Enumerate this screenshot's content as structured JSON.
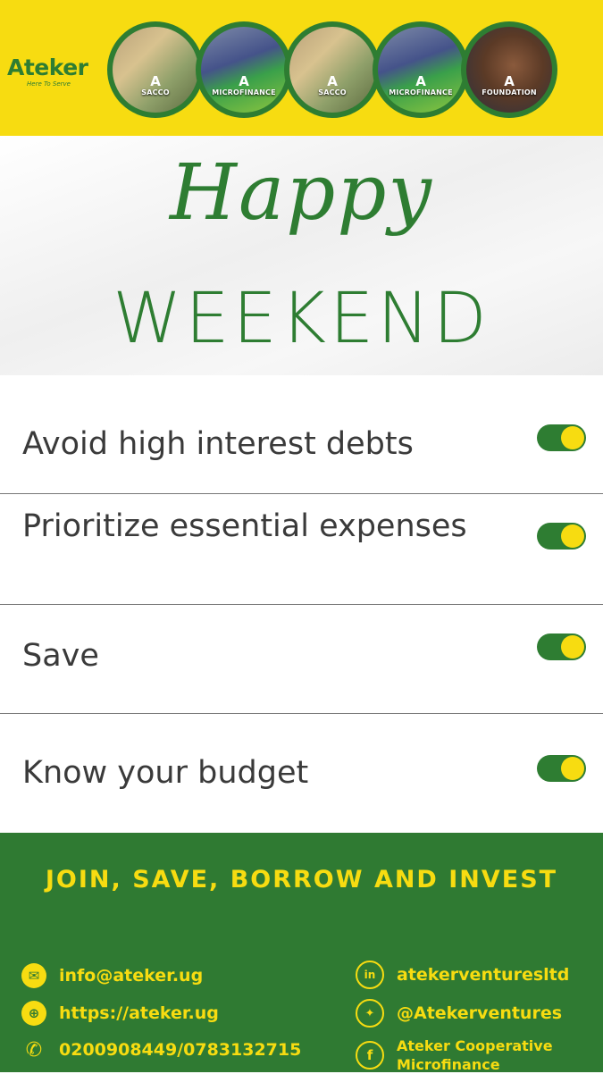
{
  "header": {
    "logo": "Ateker",
    "tagline": "Here To Serve",
    "circles": [
      {
        "mark": "A",
        "label": "SACCO"
      },
      {
        "mark": "A",
        "label": "MICROFINANCE"
      },
      {
        "mark": "A",
        "label": "SACCO"
      },
      {
        "mark": "A",
        "label": "MICROFINANCE"
      },
      {
        "mark": "A",
        "label": "FOUNDATION"
      }
    ]
  },
  "hero": {
    "line1": "Happy",
    "line2": "WEEKEND"
  },
  "checklist": [
    {
      "text": "Avoid high interest debts",
      "checked": true
    },
    {
      "text": "Prioritize essential expenses",
      "checked": true
    },
    {
      "text": "Save",
      "checked": true
    },
    {
      "text": "Know your budget",
      "checked": true
    }
  ],
  "footer": {
    "cta": "JOIN, SAVE, BORROW AND INVEST",
    "email": "info@ateker.ug",
    "website": "https://ateker.ug",
    "phone": "0200908449/0783132715",
    "linkedin": "atekerventuresltd",
    "twitter": "@Atekerventures",
    "facebook": "Ateker Cooperative Microfinance"
  },
  "colors": {
    "brand_green": "#2e7d32",
    "brand_yellow": "#f7dc11"
  }
}
